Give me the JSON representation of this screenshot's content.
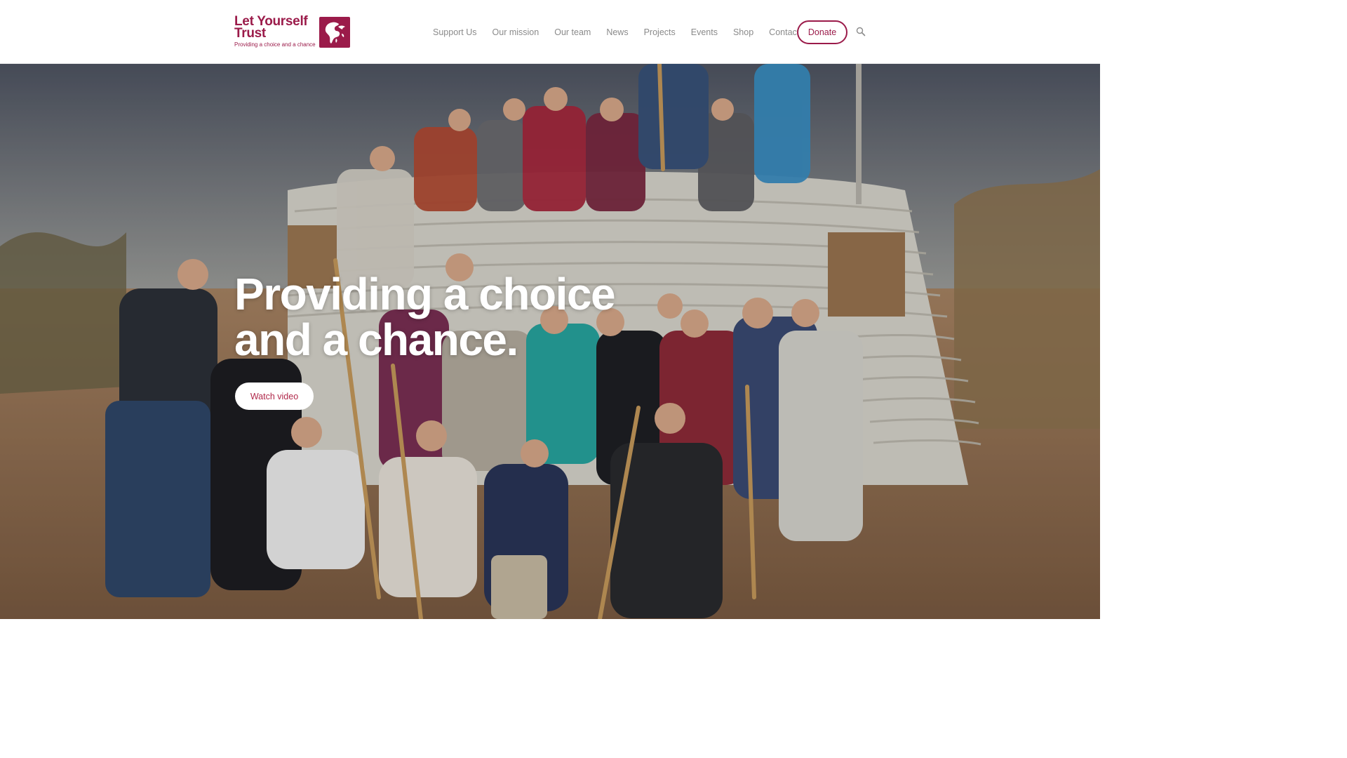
{
  "brand": {
    "name_line1": "Let Yourself",
    "name_line2": "Trust",
    "tagline": "Providing a choice and a chance",
    "logo_icon": "globe-dove-icon",
    "color": "#9b1b4a"
  },
  "nav": {
    "items": [
      {
        "label": "Support Us"
      },
      {
        "label": "Our mission"
      },
      {
        "label": "Our team"
      },
      {
        "label": "News"
      },
      {
        "label": "Projects"
      },
      {
        "label": "Events"
      },
      {
        "label": "Shop"
      },
      {
        "label": "Contact"
      }
    ],
    "donate_label": "Donate",
    "search_icon": "search-icon"
  },
  "hero": {
    "title_line1": "Providing a choice",
    "title_line2": "and a chance.",
    "button_label": "Watch video",
    "button_text_color": "#b0284a"
  }
}
